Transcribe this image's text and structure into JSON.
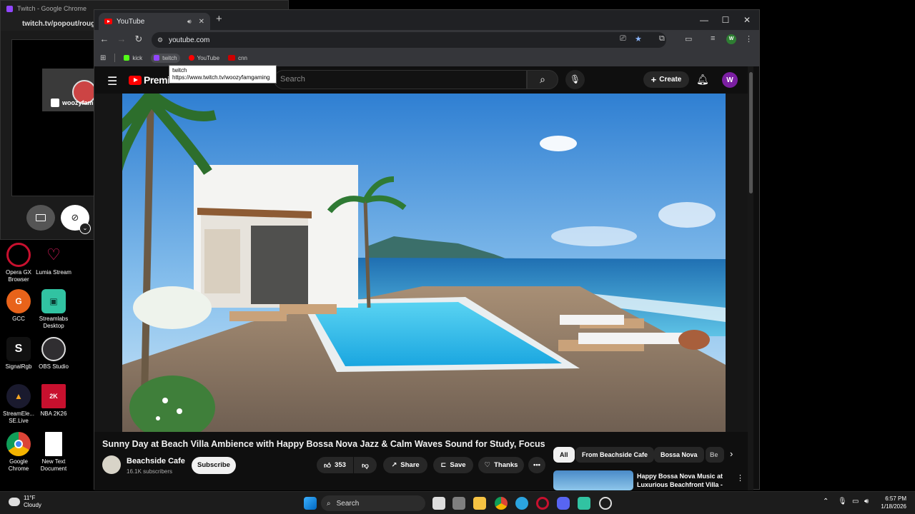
{
  "twitch_window": {
    "title": "Twitch - Google Chrome",
    "address": "twitch.tv/popout/rough_",
    "streamer_tag": "woozyfam"
  },
  "desktop_icons": [
    {
      "label": "Opera GX Browser",
      "icon": "opera-gx-icon",
      "color": "#c8102e"
    },
    {
      "label": "Lumia Stream",
      "icon": "lumia-stream-icon",
      "color": "#e91e63"
    },
    {
      "label": "GCC",
      "icon": "gcc-icon",
      "color": "#e8631a"
    },
    {
      "label": "Streamlabs Desktop",
      "icon": "streamlabs-icon",
      "color": "#31c3a2"
    },
    {
      "label": "SignalRgb",
      "icon": "signalrgb-icon",
      "color": "#222222"
    },
    {
      "label": "OBS Studio",
      "icon": "obs-studio-icon",
      "color": "#302e31"
    },
    {
      "label": "StreamEle... SE.Live",
      "icon": "streamelements-icon",
      "color": "#1a1a2e"
    },
    {
      "label": "NBA 2K26",
      "icon": "nba2k26-icon",
      "color": "#c8102e"
    },
    {
      "label": "Google Chrome",
      "icon": "chrome-icon",
      "color": "#4285f4"
    },
    {
      "label": "New Text Document",
      "icon": "text-document-icon",
      "color": "#ffffff"
    }
  ],
  "chrome": {
    "tab_title": "YouTube",
    "new_tab": "+",
    "address": "youtube.com",
    "bookmarks": [
      {
        "label": "kick",
        "color": "#53fc18"
      },
      {
        "label": "twitch",
        "color": "#9146ff"
      },
      {
        "label": "YouTube",
        "color": "#ff0000"
      },
      {
        "label": "cnn",
        "color": "#cc0000"
      }
    ],
    "tooltip": {
      "title": "twitch",
      "url": "https://www.twitch.tv/woozyfamgaming"
    },
    "profile_initial": "W"
  },
  "youtube": {
    "logo_text": "Premium",
    "search_placeholder": "Search",
    "create_label": "Create",
    "avatar_initial": "W",
    "video": {
      "title": "Sunny Day at Beach Villa Ambience with Happy Bossa Nova Jazz & Calm Waves Sound for Study, Focus",
      "channel": "Beachside Cafe",
      "subscribers": "16.1K subscribers",
      "subscribe_label": "Subscribe",
      "likes": "353",
      "share_label": "Share",
      "save_label": "Save",
      "thanks_label": "Thanks"
    },
    "chips": [
      "All",
      "From Beachside Cafe",
      "Bossa Nova",
      "Be"
    ],
    "recommendation": {
      "title": "Happy Bossa Nova Music at Luxurious Beachfront Villa -"
    }
  },
  "taskbar": {
    "weather_temp": "11°F",
    "weather_desc": "Cloudy",
    "search_label": "Search",
    "time": "6:57 PM",
    "date": "1/18/2026"
  }
}
